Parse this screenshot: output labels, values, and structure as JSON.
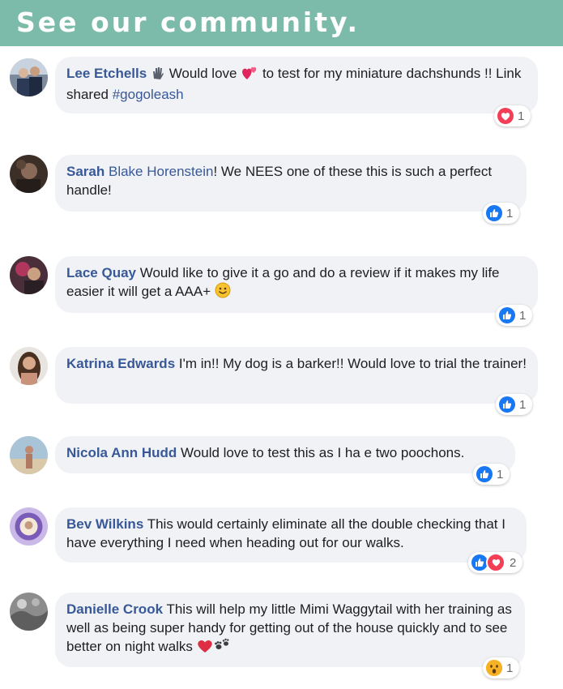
{
  "banner": {
    "title": "See our community."
  },
  "comments": [
    {
      "author": "Lee Etchells",
      "text_1": "Would love",
      "text_2": "to test for my miniature dachshunds !! Link shared",
      "hashtag": "#gogoleash",
      "reaction": "love",
      "count": "1"
    },
    {
      "author": "Sarah",
      "author_2": "Blake Horenstein",
      "text": "! We NEES one of these this is such a perfect handle!",
      "reaction": "like",
      "count": "1"
    },
    {
      "author": "Lace Quay",
      "text": "Would like to give it a go and do a review if it makes my life easier it will get a AAA+",
      "reaction": "like",
      "count": "1"
    },
    {
      "author": "Katrina Edwards",
      "text": "I'm in!! My dog is a barker!! Would love to trial the trainer!",
      "reaction": "like",
      "count": "1"
    },
    {
      "author": "Nicola Ann Hudd",
      "text": "Would love to test this as I ha e two poochons.",
      "reaction": "like",
      "count": "1"
    },
    {
      "author": "Bev Wilkins",
      "text": "This would certainly eliminate all the double checking that I have everything I need when heading out for our walks.",
      "reaction": "like-love",
      "count": "2"
    },
    {
      "author": "Danielle Crook",
      "text": "This will help my little Mimi Waggytail with her training as well as being super handy for getting out of the house quickly and to see better on night walks",
      "reaction": "wow",
      "count": "1"
    }
  ],
  "colors": {
    "banner": "#7cbba9",
    "author": "#385898",
    "bubble": "#f0f2f5",
    "like": "#1877f2",
    "love": "#f33e58"
  }
}
